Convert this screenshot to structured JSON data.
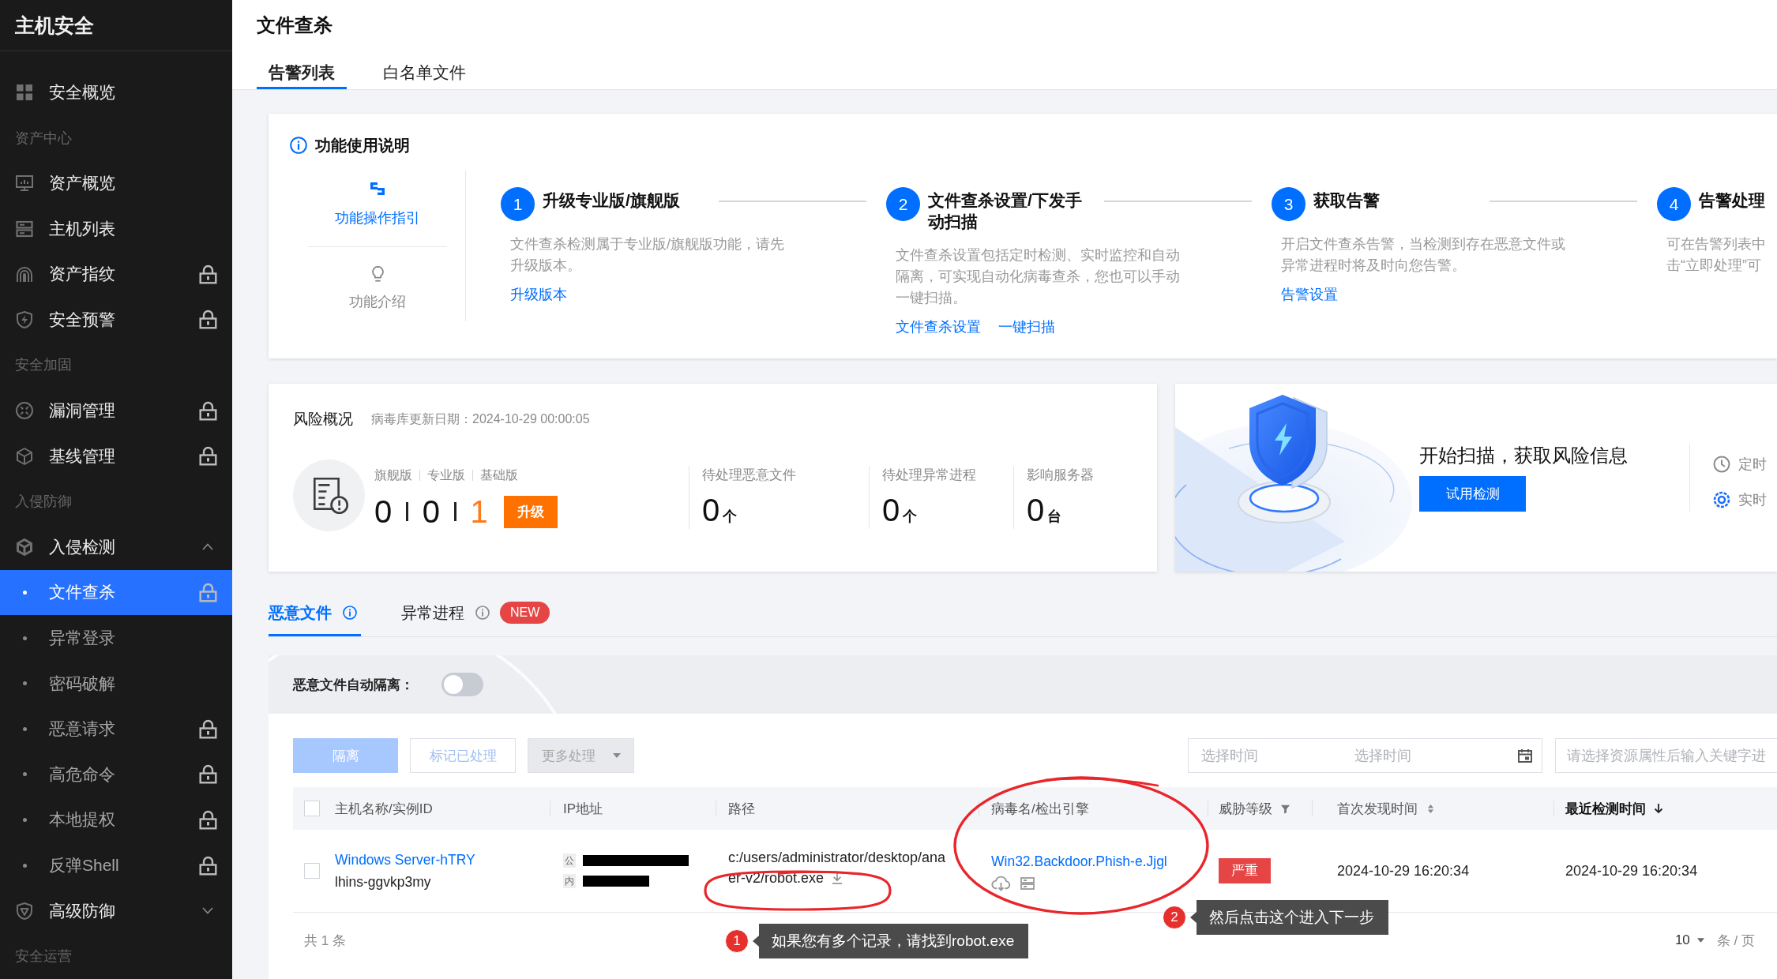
{
  "sidebar": {
    "title": "主机安全",
    "items": [
      {
        "kind": "link",
        "label": "安全概览",
        "selected": false,
        "locked": false
      },
      {
        "kind": "group",
        "label": "资产中心"
      },
      {
        "kind": "link",
        "label": "资产概览",
        "selected": false,
        "locked": false
      },
      {
        "kind": "link",
        "label": "主机列表",
        "selected": false,
        "locked": false
      },
      {
        "kind": "link",
        "label": "资产指纹",
        "selected": false,
        "locked": true
      },
      {
        "kind": "link",
        "label": "安全预警",
        "selected": false,
        "locked": true
      },
      {
        "kind": "group",
        "label": "安全加固"
      },
      {
        "kind": "link",
        "label": "漏洞管理",
        "selected": false,
        "locked": true
      },
      {
        "kind": "link",
        "label": "基线管理",
        "selected": false,
        "locked": true
      },
      {
        "kind": "group",
        "label": "入侵防御"
      },
      {
        "kind": "folder",
        "label": "入侵检测",
        "expanded": true,
        "children": [
          {
            "label": "文件查杀",
            "selected": true,
            "locked": true
          },
          {
            "label": "异常登录",
            "selected": false,
            "locked": false
          },
          {
            "label": "密码破解",
            "selected": false,
            "locked": false
          },
          {
            "label": "恶意请求",
            "selected": false,
            "locked": true
          },
          {
            "label": "高危命令",
            "selected": false,
            "locked": true
          },
          {
            "label": "本地提权",
            "selected": false,
            "locked": true
          },
          {
            "label": "反弹Shell",
            "selected": false,
            "locked": true
          }
        ]
      },
      {
        "kind": "folder",
        "label": "高级防御",
        "expanded": false
      },
      {
        "kind": "group",
        "label": "安全运营"
      }
    ]
  },
  "page": {
    "title": "文件查杀",
    "tabs": [
      {
        "label": "告警列表",
        "selected": true
      },
      {
        "label": "白名单文件",
        "selected": false
      }
    ]
  },
  "guide": {
    "title": "功能使用说明",
    "side_links": [
      {
        "label": "功能操作指引",
        "selected": true
      },
      {
        "label": "功能介绍",
        "selected": false
      }
    ],
    "steps": [
      {
        "number": "1",
        "title": "升级专业版/旗舰版",
        "desc_lines": [
          "文件查杀检测属于专业版/旗舰版功能，请先",
          "升级版本。"
        ],
        "links": [
          "升级版本"
        ]
      },
      {
        "number": "2",
        "title": "文件查杀设置/下发手动扫描",
        "desc_lines": [
          "文件查杀设置包括定时检测、实时监控和自动",
          "隔离，可实现自动化病毒查杀，您也可以手动",
          "一键扫描。"
        ],
        "links": [
          "文件查杀设置",
          "一键扫描"
        ]
      },
      {
        "number": "3",
        "title": "获取告警",
        "desc_lines": [
          "开启文件查杀告警，当检测到存在恶意文件或",
          "异常进程时将及时向您告警。"
        ],
        "links": [
          "告警设置"
        ]
      },
      {
        "number": "4",
        "title": "告警处理",
        "desc_lines": [
          "可在告警列表中",
          "击“立即处理”可"
        ]
      }
    ]
  },
  "risk": {
    "title": "风险概况",
    "update_info": "病毒库更新日期：2024-10-29 00:00:05",
    "editions": [
      {
        "label": "旗舰版",
        "count": "0",
        "current": false
      },
      {
        "label": "专业版",
        "count": "0",
        "current": false
      },
      {
        "label": "基础版",
        "count": "1",
        "current": true
      }
    ],
    "upgrade_button": "升级",
    "stats": [
      {
        "label": "待处理恶意文件",
        "value": "0",
        "unit": "个"
      },
      {
        "label": "待处理异常进程",
        "value": "0",
        "unit": "个"
      },
      {
        "label": "影响服务器",
        "value": "0",
        "unit": "台"
      }
    ]
  },
  "scan_promo": {
    "headline": "开始扫描，获取风险信息",
    "button": "试用检测",
    "features": [
      "定时",
      "实时"
    ]
  },
  "result_tabs": [
    {
      "label": "恶意文件",
      "selected": true
    },
    {
      "label": "异常进程",
      "selected": false,
      "badge": "NEW"
    }
  ],
  "auto_isolation": {
    "label": "恶意文件自动隔离：",
    "on": false
  },
  "toolbar": {
    "buttons": [
      {
        "kind": "primary",
        "label": "隔离",
        "disabled": true
      },
      {
        "kind": "outline",
        "label": "标记已处理",
        "disabled": true
      },
      {
        "kind": "dropdown",
        "label": "更多处理",
        "disabled": true
      }
    ],
    "date_range": {
      "start_placeholder": "选择时间",
      "end_placeholder": "选择时间"
    },
    "search": {
      "placeholder": "请选择资源属性后输入关键字进"
    }
  },
  "table": {
    "select_all": {
      "checked": false
    },
    "columns": [
      {
        "label": "主机名称/实例ID",
        "kind": "plain"
      },
      {
        "label": "IP地址",
        "kind": "plain"
      },
      {
        "label": "路径",
        "kind": "plain"
      },
      {
        "label": "病毒名/检出引擎",
        "kind": "plain"
      },
      {
        "label": "威胁等级",
        "kind": "filter"
      },
      {
        "label": "首次发现时间",
        "kind": "sortable"
      },
      {
        "label": "最近检测时间",
        "kind": "sorted_desc"
      }
    ],
    "rows": [
      {
        "selected": false,
        "host_name": "Windows Server-hTRY",
        "instance_id": "lhins-ggvkp3my",
        "ip_tags": [
          "公",
          "内"
        ],
        "path_lines": [
          "c:/users/administrator/desktop/ana",
          "er-v2/robot.exe"
        ],
        "virus_name": "Win32.Backdoor.Phish-e.Jjgl",
        "threat": {
          "label": "严重",
          "color": "#e54545"
        },
        "first_seen": "2024-10-29 16:20:34",
        "last_seen": "2024-10-29 16:20:34"
      }
    ],
    "total": "共 1 条",
    "page_size": "10",
    "page_size_unit": "条 / 页"
  },
  "annotations": [
    {
      "number": "1",
      "text": "如果您有多个记录，请找到robot.exe"
    },
    {
      "number": "2",
      "text": "然后点击这个进入下一步"
    }
  ]
}
